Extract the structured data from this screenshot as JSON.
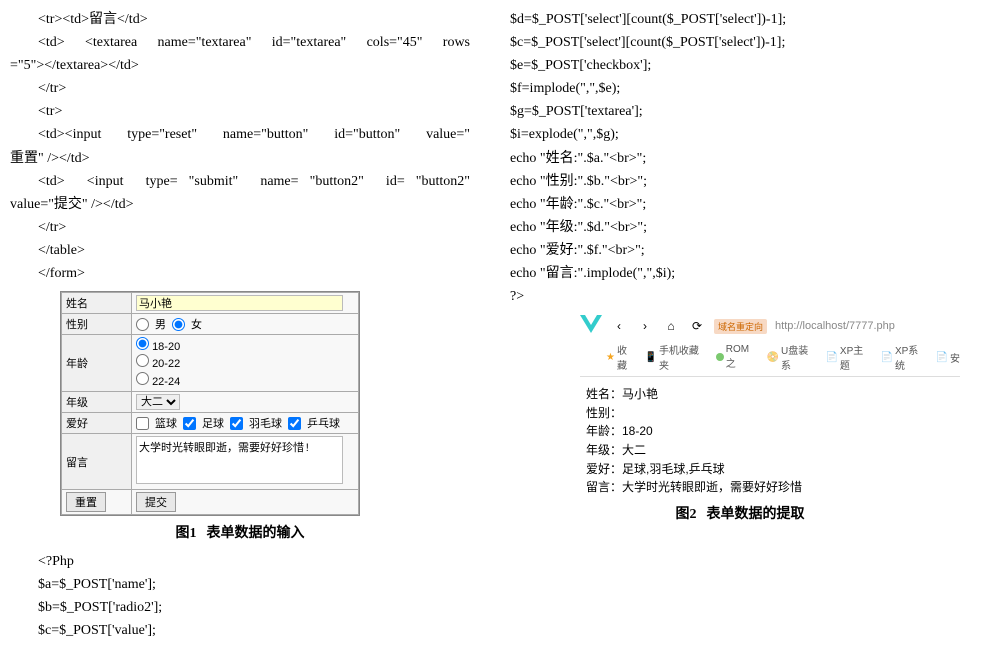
{
  "left_code_top": [
    {
      "indent": 1,
      "text": "<tr><td>留言</td>"
    },
    {
      "indent": 1,
      "text": "<td> <textarea name=\"textarea\" id=\"textarea\" cols=\"45\" rows",
      "justify": true
    },
    {
      "indent": 0,
      "text": "=\"5\"></textarea></td>"
    },
    {
      "indent": 1,
      "text": "</tr>"
    },
    {
      "indent": 1,
      "text": "<tr>"
    },
    {
      "indent": 1,
      "text": "<td><input type=\"reset\" name=\"button\" id=\"button\" value=\"",
      "justify": true
    },
    {
      "indent": 0,
      "text": "重置\" /></td>"
    },
    {
      "indent": 1,
      "text": "<td>  <input  type= \"submit\"  name= \"button2\"  id= \"button2\"",
      "justify": true
    },
    {
      "indent": 0,
      "text": "value=\"提交\" /></td>"
    },
    {
      "indent": 1,
      "text": "</tr>"
    },
    {
      "indent": 1,
      "text": "</table>"
    },
    {
      "indent": 1,
      "text": "</form>"
    }
  ],
  "form": {
    "rows": {
      "name_label": "姓名",
      "name_value": "马小艳",
      "sex_label": "性别",
      "sex_m": "男",
      "sex_f": "女",
      "age_label": "年龄",
      "age_opts": [
        "18-20",
        "20-22",
        "22-24"
      ],
      "grade_label": "年级",
      "grade_value": "大二",
      "hobby_label": "爱好",
      "hobbies": [
        "篮球",
        "足球",
        "羽毛球",
        "乒乓球"
      ],
      "msg_label": "留言",
      "msg_value": "大学时光转眼即逝，需要好好珍惜!",
      "reset_btn": "重置",
      "submit_btn": "提交"
    }
  },
  "fig1": {
    "num": "图1",
    "title": "表单数据的输入"
  },
  "php_block_left": [
    "<?Php",
    "$a=$_POST['name'];",
    "$b=$_POST['radio2'];",
    "$c=$_POST['value'];"
  ],
  "right_code": [
    "$d=$_POST['select'][count($_POST['select'])-1];",
    "$c=$_POST['select'][count($_POST['select'])-1];",
    "$e=$_POST['checkbox'];",
    "$f=implode(\",\",$e);",
    "$g=$_POST['textarea'];",
    "$i=explode(\",\",$g);",
    "echo \"姓名:\".$a.\"<br>\";",
    "echo \"性别:\".$b.\"<br>\";",
    "echo \"年龄:\".$c.\"<br>\";",
    "echo \"年级:\".$d.\"<br>\";",
    "echo \"爱好:\".$f.\"<br>\";",
    "echo \"留言:\".implode(\",\",$i);",
    "?>"
  ],
  "browser": {
    "nav": {
      "back": "‹",
      "forward": "›",
      "home": "⌂",
      "reload": "⟳"
    },
    "addr_badge": "域名重定向",
    "url": "http://localhost/7777.php",
    "bookmarks": [
      "收藏",
      "手机收藏夹",
      "ROM之",
      "U盘装系",
      "XP主题",
      "XP系统",
      "安"
    ]
  },
  "result_lines": [
    "姓名：马小艳",
    "性别：",
    "年龄：18-20",
    "年级：大二",
    "爱好：足球,羽毛球,乒乓球",
    "留言：大学时光转眼即逝，需要好好珍惜"
  ],
  "fig2": {
    "num": "图2",
    "title": "表单数据的提取"
  }
}
